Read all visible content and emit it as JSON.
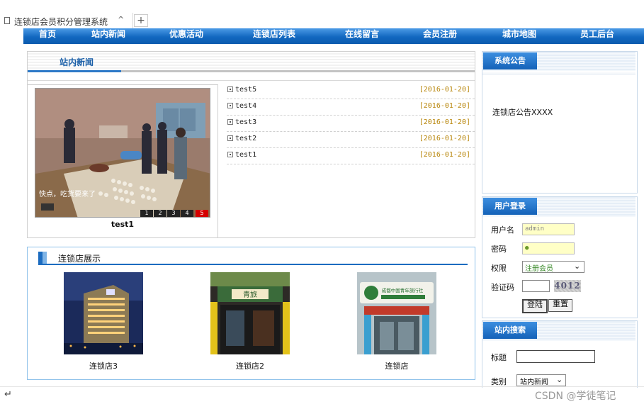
{
  "browser": {
    "tab_title": "连锁店会员积分管理系统",
    "new_tab": "+"
  },
  "nav": {
    "items": [
      "首页",
      "站内新闻",
      "优惠活动",
      "连锁店列表",
      "在线留言",
      "会员注册",
      "城市地图",
      "员工后台"
    ]
  },
  "news": {
    "title": "站内新闻",
    "slideshow": {
      "caption": "test1",
      "photo_overlay_text": "快点，吃货要来了",
      "pages": [
        "1",
        "2",
        "3",
        "4",
        "5"
      ],
      "active_page": "5"
    },
    "items": [
      {
        "title": "test5",
        "date": "[2016-01-20]"
      },
      {
        "title": "test4",
        "date": "[2016-01-20]"
      },
      {
        "title": "test3",
        "date": "[2016-01-20]"
      },
      {
        "title": "test2",
        "date": "[2016-01-20]"
      },
      {
        "title": "test1",
        "date": "[2016-01-20]"
      }
    ]
  },
  "stores": {
    "title": "连锁店展示",
    "items": [
      {
        "caption": "连锁店3"
      },
      {
        "caption": "连锁店2",
        "sign_text": "青旅"
      },
      {
        "caption": "连锁店",
        "sign_text": "成都中国青年旅行社"
      }
    ]
  },
  "notice": {
    "title": "系统公告",
    "text": "连锁店公告XXXX"
  },
  "login": {
    "title": "用户登录",
    "username_label": "用户名",
    "username_value": "admin",
    "password_label": "密码",
    "password_value": "●",
    "role_label": "权限",
    "role_value": "注册会员",
    "captcha_label": "验证码",
    "captcha_code": "4012",
    "login_button": "登陆",
    "reset_button": "重置"
  },
  "search": {
    "title": "站内搜索",
    "title_label": "标题",
    "category_label": "类别",
    "category_value": "站内新闻"
  },
  "footer": {
    "watermark": "CSDN @学徒笔记",
    "return_glyph": "↵"
  },
  "colors": {
    "nav_blue": "#1268c0",
    "accent_blue": "#2d79c7",
    "date_gold": "#b8860b",
    "input_yellow": "#ffffc6"
  }
}
